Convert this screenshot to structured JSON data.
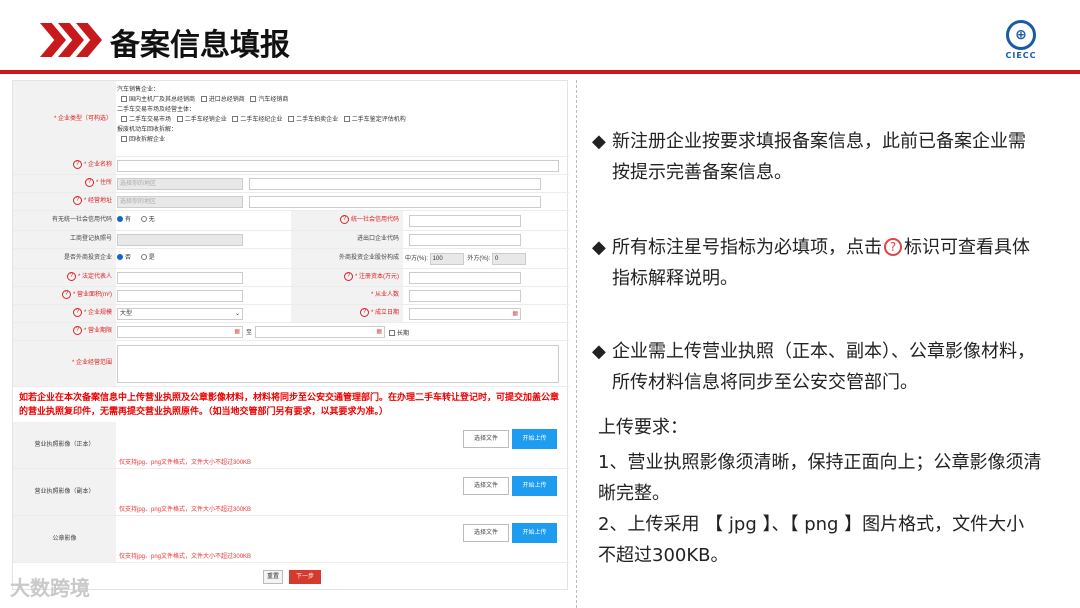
{
  "header": {
    "title": "备案信息填报",
    "logo_text": "CIECC",
    "accent_color": "#c8191c"
  },
  "form": {
    "enterprise_type_label": "* 企业类型（可构选）",
    "auto_sales_title": "汽车销售企业：",
    "auto_sales_opts": [
      "国内主机厂及其总经销商",
      "进口总经销商",
      "汽车经销商"
    ],
    "used_market_title": "二手车交易市场及经营主体：",
    "used_market_opts": [
      "二手车交易市场",
      "二手车经销企业",
      "二手车经纪企业",
      "二手车拍卖企业",
      "二手车鉴定评估机构"
    ],
    "scrap_title": "报废机动车回收拆解：",
    "scrap_opts": [
      "回收拆解企业"
    ],
    "name_label": "* 企业名称",
    "address_label": "* 住所",
    "address_placeholder": "选择你的地区",
    "biz_address_label": "* 经营地址",
    "biz_address_placeholder": "选择你的地区",
    "credit_code_have_label": "有无统一社会信用代码",
    "opt_yes": "有",
    "opt_no": "无",
    "credit_code_label": "统一社会信用代码",
    "reg_no_label": "工商登记执照号",
    "import_export_label": "进出口企业代码",
    "foreign_invest_label": "是否外商投资企业",
    "opt_no2": "否",
    "opt_yes2": "是",
    "foreign_share_label": "外商投资企业股份构成",
    "cn_share_label": "中方(%):",
    "cn_share_value": "100",
    "foreign_pct_label": "外方(%):",
    "foreign_pct_value": "0",
    "legal_rep_label": "* 法定代表人",
    "capital_label": "* 注册资本(万元)",
    "area_label": "* 营业面积(m²)",
    "staff_label": "* 从业人数",
    "scale_label": "* 企业规模",
    "scale_value": "大型",
    "found_date_label": "* 成立日期",
    "term_label": "* 营业期限",
    "term_to": "至",
    "long_term": "长期",
    "scope_label": "* 企业经营范围",
    "warning": "如若企业在本次备案信息中上传营业执照及公章影像材料，材料将同步至公安交通管理部门。在办理二手车转让登记时，可提交加盖公章的营业执照复印件，无需再提交营业执照原件。（如当地交管部门另有要求，以其要求为准。）",
    "uploads": [
      {
        "label": "营业执照影像（正本）",
        "hint": "仅支持jpg、png文件格式，文件大小不超过300KB"
      },
      {
        "label": "营业执照影像（副本）",
        "hint": "仅支持jpg、png文件格式，文件大小不超过300KB"
      },
      {
        "label": "公章影像",
        "hint": "仅支持jpg、png文件格式，文件大小不超过300KB"
      }
    ],
    "choose_file": "选择文件",
    "start_upload": "开始上传",
    "reset": "重置",
    "next": "下一步"
  },
  "notes": {
    "bullet1_a": "新注册企业按要求填报备案信息，此前已备案企业需",
    "bullet1_b": "按提示完善备案信息。",
    "bullet2_a": "所有标注星号指标为必填项，点击",
    "bullet2_icon": "?",
    "bullet2_tail": "标识可查看具体",
    "bullet2_b": "指标解释说明。",
    "bullet3_a": "企业需上传营业执照（正本、副本）、公章影像材料，",
    "bullet3_b": "所传材料信息将同步至公安交管部门。",
    "req_title": "上传要求：",
    "req1_a": "1、营业执照影像须清晰，保持正面向上；公章影像须清",
    "req1_b": "晰完整。",
    "req2_a": "2、上传采用 【 jpg 】、【 png 】图片格式，文件大小",
    "req2_b": "不超过300KB。"
  },
  "watermark": "大数跨境"
}
